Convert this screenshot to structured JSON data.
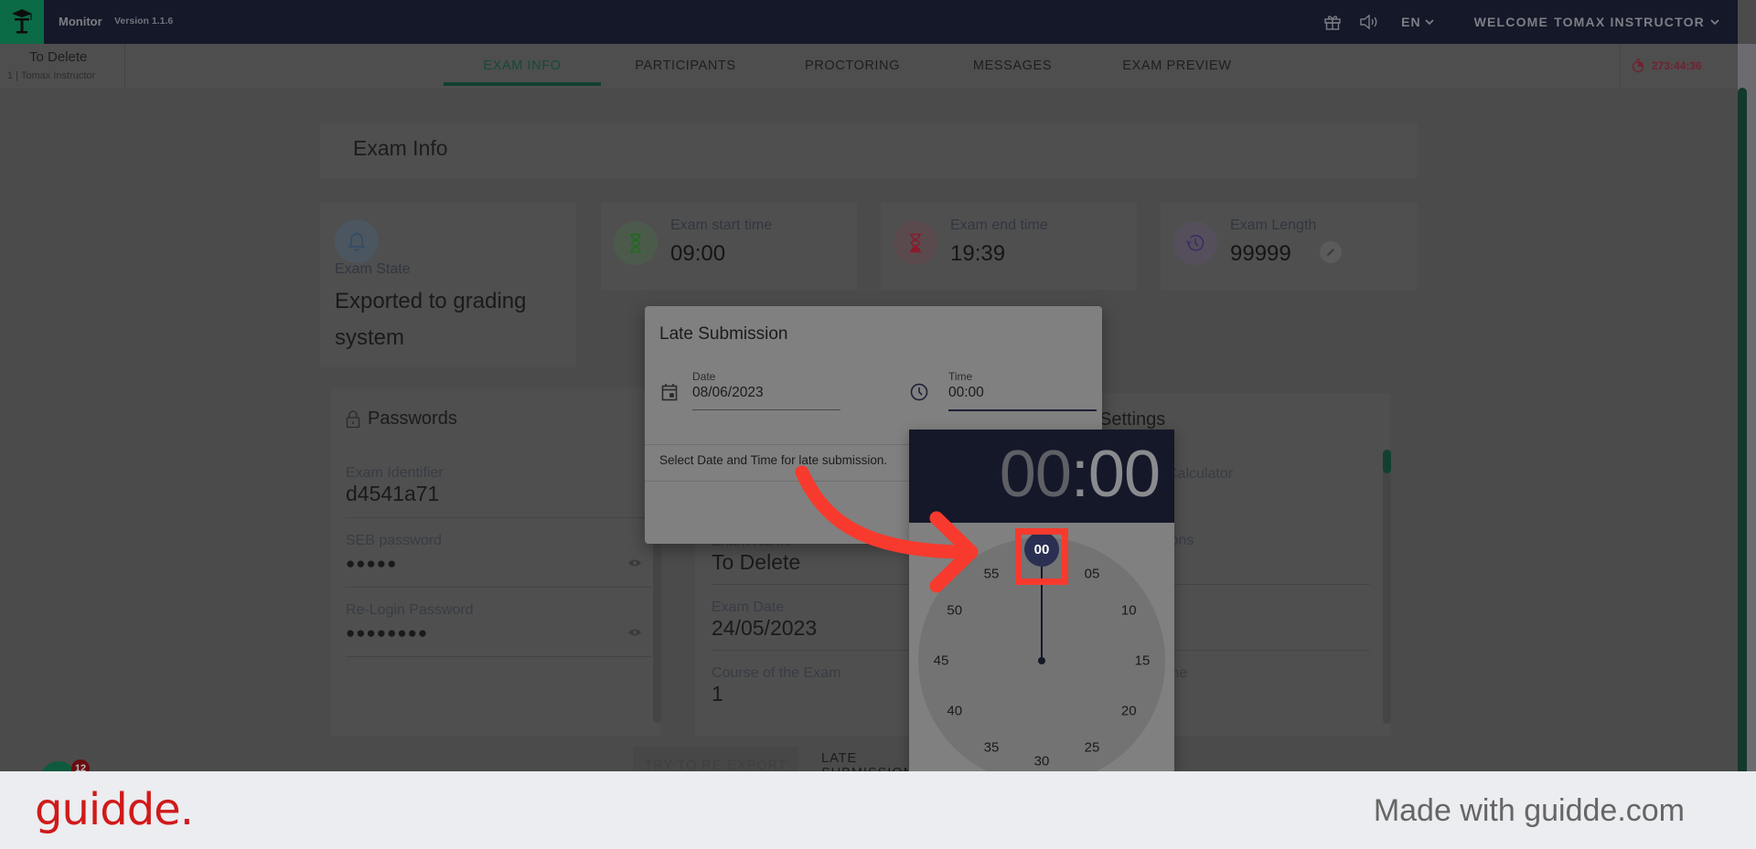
{
  "app": {
    "name": "Monitor",
    "version": "Version 1.1.6",
    "language": "EN",
    "welcome": "WELCOME",
    "user": "TOMAX INSTRUCTOR"
  },
  "exam_header": {
    "title": "To Delete",
    "subtitle": "1  |  Tomax Instructor",
    "timer": "273:44:36"
  },
  "tabs": [
    {
      "label": "EXAM INFO",
      "active": true
    },
    {
      "label": "PARTICIPANTS",
      "active": false
    },
    {
      "label": "PROCTORING",
      "active": false
    },
    {
      "label": "MESSAGES",
      "active": false
    },
    {
      "label": "EXAM PREVIEW",
      "active": false
    }
  ],
  "page": {
    "title": "Exam Info",
    "exam_state": {
      "label": "Exam State",
      "value": "Exported to grading system"
    },
    "stats": [
      {
        "label": "Exam start time",
        "value": "09:00",
        "icon": "hourglass-start-icon"
      },
      {
        "label": "Exam end time",
        "value": "19:39",
        "icon": "hourglass-end-icon"
      },
      {
        "label": "Exam Length",
        "value": "99999",
        "icon": "history-icon"
      }
    ],
    "passwords": {
      "title": "Passwords",
      "rows": [
        {
          "label": "Exam Identifier",
          "value": "d4541a71"
        },
        {
          "label": "SEB password",
          "value": "●●●●●"
        },
        {
          "label": "Re-Login Password",
          "value": "●●●●●●●●"
        }
      ]
    },
    "details": [
      {
        "label": "Exam Name",
        "value": "To Delete"
      },
      {
        "label": "Exam Date",
        "value": "24/05/2023"
      },
      {
        "label": "Course of the Exam",
        "value": "1"
      }
    ],
    "settings": {
      "title": "Settings",
      "rows": [
        "Calculator",
        "ions",
        "",
        "me"
      ]
    },
    "buttons": {
      "reexport": "TRY TO RE-EXPORT",
      "late_submission": "LATE SUBMISSION"
    },
    "chat_badge_count": "12"
  },
  "dialog": {
    "title": "Late Submission",
    "date_label": "Date",
    "date_value": "08/06/2023",
    "time_label": "Time",
    "time_value": "00:00",
    "message": "Select Date and Time for late submission."
  },
  "time_picker": {
    "hours": "00",
    "separator": ":",
    "minutes": "00",
    "selected_minute": "00",
    "minute_labels": [
      "00",
      "05",
      "10",
      "15",
      "20",
      "25",
      "30",
      "35",
      "40",
      "45",
      "50",
      "55"
    ]
  },
  "footer": {
    "brand": "guidde.",
    "made_with": "Made with guidde.com"
  }
}
